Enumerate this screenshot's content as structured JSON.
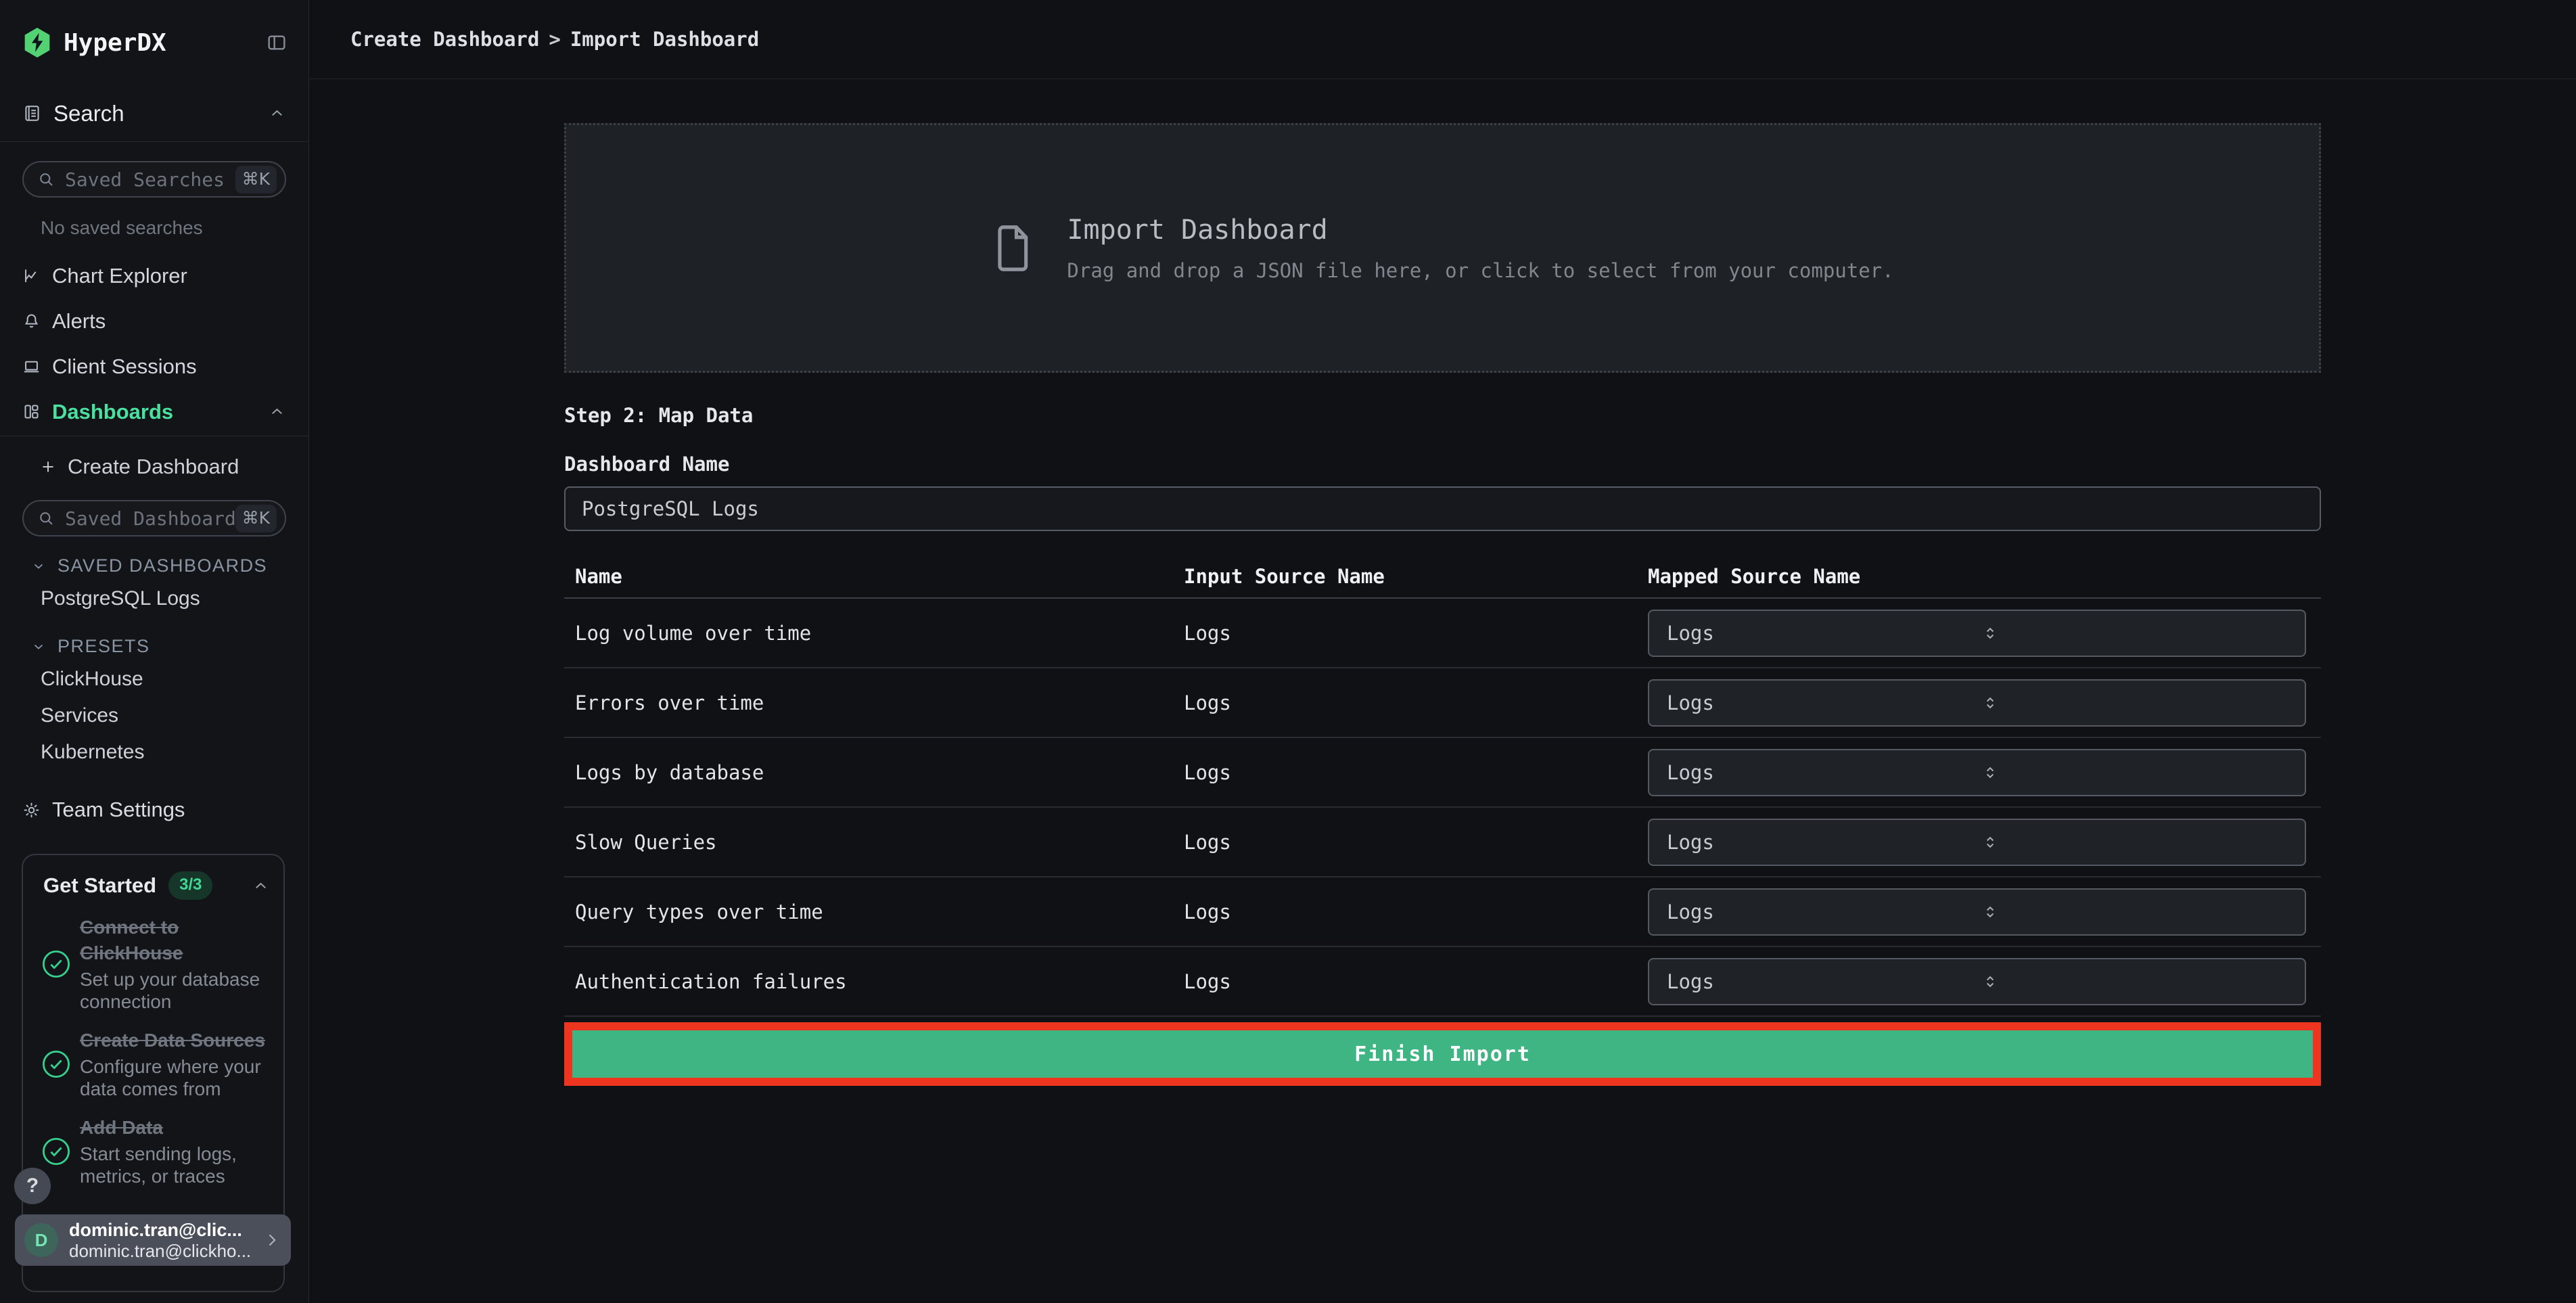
{
  "app": {
    "name": "HyperDX"
  },
  "colors": {
    "accent_green": "#4be0a0",
    "button_green": "#3eb583",
    "annotation_red": "#ee3520",
    "logo_green": "#52d273",
    "badge_bg": "#17362a",
    "badge_text": "#41d794",
    "avatar_bg": "#3d655a",
    "avatar_text": "#74e6b4"
  },
  "sidebar": {
    "search_section": {
      "label": "Search",
      "input_placeholder": "Saved Searches",
      "kbd": "⌘K",
      "empty_text": "No saved searches"
    },
    "nav": [
      {
        "label": "Chart Explorer"
      },
      {
        "label": "Alerts"
      },
      {
        "label": "Client Sessions"
      },
      {
        "label": "Dashboards"
      }
    ],
    "dashboards_section": {
      "create_label": "Create Dashboard",
      "input_placeholder": "Saved Dashboards",
      "kbd": "⌘K",
      "groups": [
        {
          "label": "SAVED DASHBOARDS",
          "items": [
            "PostgreSQL Logs"
          ]
        },
        {
          "label": "PRESETS",
          "items": [
            "ClickHouse",
            "Services",
            "Kubernetes"
          ]
        }
      ]
    },
    "team_settings_label": "Team Settings",
    "get_started": {
      "title": "Get Started",
      "badge": "3/3",
      "items": [
        {
          "title": "Connect to ClickHouse",
          "subtitle": "Set up your database connection"
        },
        {
          "title": "Create Data Sources",
          "subtitle": "Configure where your data comes from"
        },
        {
          "title": "Add Data",
          "subtitle": "Start sending logs, metrics, or traces"
        }
      ]
    },
    "help_label": "?",
    "user": {
      "initial": "D",
      "name": "dominic.tran@clic...",
      "email": "dominic.tran@clickho..."
    }
  },
  "main": {
    "breadcrumb": {
      "part1": "Create Dashboard",
      "separator": ">",
      "part2": "Import Dashboard"
    },
    "dropzone": {
      "title": "Import Dashboard",
      "subtitle": "Drag and drop a JSON file here, or click to select from your computer."
    },
    "step_label": "Step 2: Map Data",
    "name_label": "Dashboard Name",
    "name_value": "PostgreSQL Logs",
    "table": {
      "columns": [
        "Name",
        "Input Source Name",
        "Mapped Source Name"
      ],
      "rows": [
        {
          "name": "Log volume over time",
          "input_source": "Logs",
          "mapped_source": "Logs"
        },
        {
          "name": "Errors over time",
          "input_source": "Logs",
          "mapped_source": "Logs"
        },
        {
          "name": "Logs by database",
          "input_source": "Logs",
          "mapped_source": "Logs"
        },
        {
          "name": "Slow Queries",
          "input_source": "Logs",
          "mapped_source": "Logs"
        },
        {
          "name": "Query types over time",
          "input_source": "Logs",
          "mapped_source": "Logs"
        },
        {
          "name": "Authentication failures",
          "input_source": "Logs",
          "mapped_source": "Logs"
        }
      ]
    },
    "finish_button_label": "Finish Import"
  }
}
